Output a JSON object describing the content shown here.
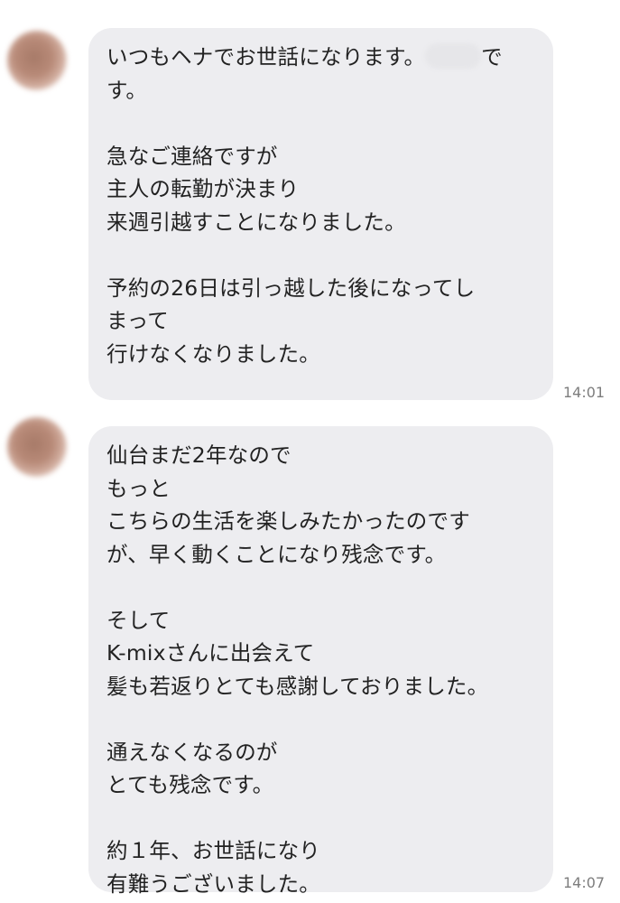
{
  "messages": [
    {
      "lines": [
        {
          "text": "いつもヘナでお世話になります。",
          "tail": "で"
        },
        {
          "text": "す。"
        },
        {
          "text": ""
        },
        {
          "text": "急なご連絡ですが"
        },
        {
          "text": "主人の転勤が決まり"
        },
        {
          "text": "来週引越すことになりました。"
        },
        {
          "text": ""
        },
        {
          "text": "予約の26日は引っ越した後になってし"
        },
        {
          "text": "まって"
        },
        {
          "text": "行けなくなりました。"
        }
      ],
      "time": "14:01"
    },
    {
      "lines": [
        {
          "text": "仙台まだ2年なので"
        },
        {
          "text": "もっと"
        },
        {
          "text": "こちらの生活を楽しみたかったのです"
        },
        {
          "text": "が、早く動くことになり残念です。"
        },
        {
          "text": ""
        },
        {
          "text": "そして"
        },
        {
          "text": "K-mixさんに出会えて"
        },
        {
          "text": "髪も若返りとても感謝しておりました。"
        },
        {
          "text": ""
        },
        {
          "text": "通えなくなるのが"
        },
        {
          "text": "とても残念です。"
        },
        {
          "text": ""
        },
        {
          "text": "約１年、お世話になり"
        },
        {
          "text": "有難うございました。"
        }
      ],
      "time": "14:07"
    }
  ]
}
